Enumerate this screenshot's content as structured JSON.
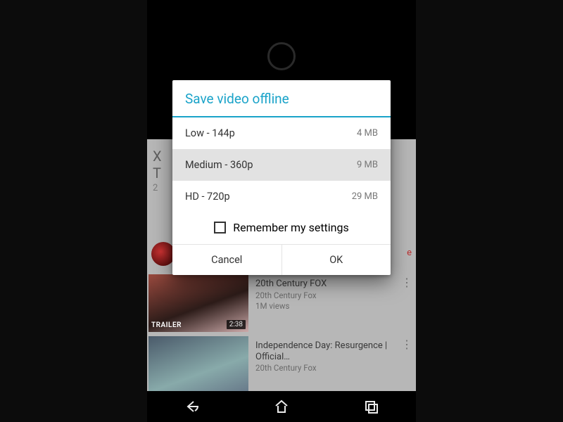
{
  "dialog": {
    "title": "Save video offline",
    "options": [
      {
        "label": "Low - 144p",
        "size": "4 MB",
        "selected": false
      },
      {
        "label": "Medium - 360p",
        "size": "9 MB",
        "selected": true
      },
      {
        "label": "HD - 720p",
        "size": "29 MB",
        "selected": false
      }
    ],
    "remember_label": "Remember my settings",
    "cancel_label": "Cancel",
    "ok_label": "OK"
  },
  "background": {
    "rows": [
      {
        "title": "20th Century FOX",
        "channel": "20th Century Fox",
        "views": "1M views",
        "duration": "2:38",
        "thumb_tag": "TRAILER"
      },
      {
        "title": "Independence Day: Resurgence | Official…",
        "channel": "20th Century Fox",
        "views": "",
        "duration": "",
        "thumb_tag": ""
      }
    ],
    "peek_lines": [
      "X",
      "T",
      "2"
    ],
    "peek_right": "e"
  },
  "navbar": {
    "back": "back-icon",
    "home": "home-icon",
    "recents": "recents-icon"
  }
}
